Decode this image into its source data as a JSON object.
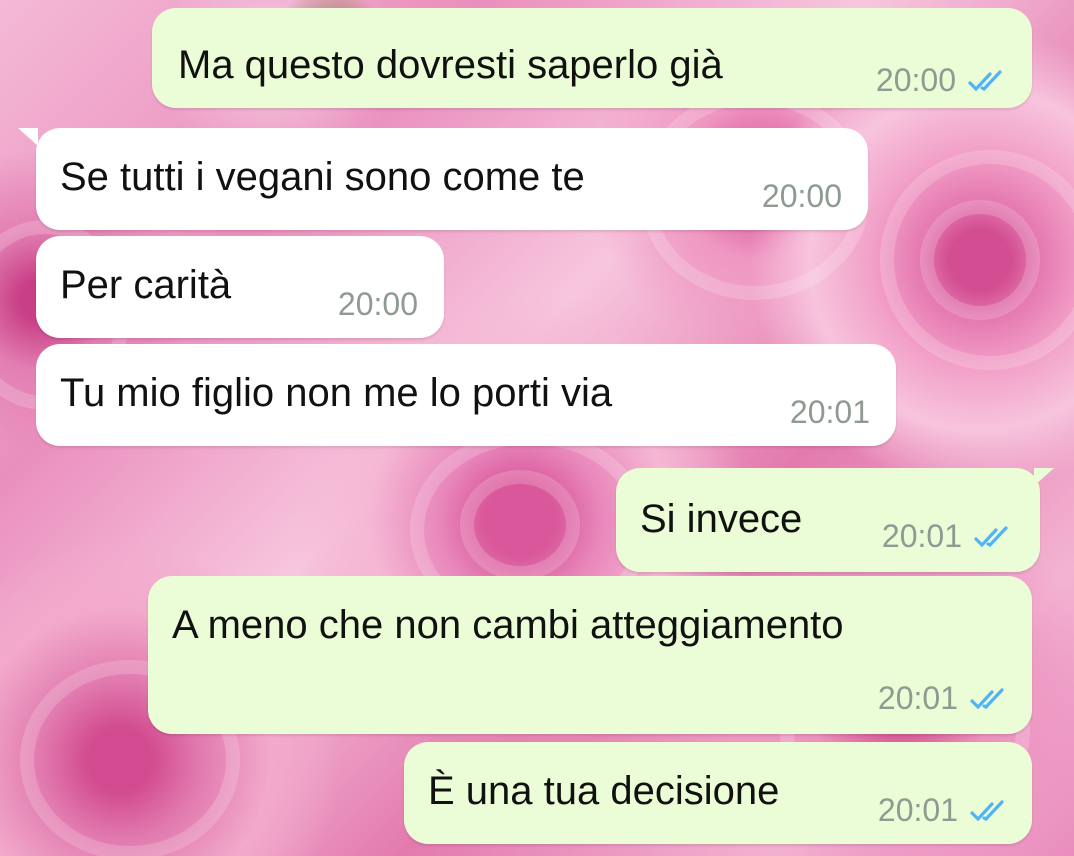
{
  "chat": {
    "messages": [
      {
        "text": "Ma questo dovresti saperlo già",
        "time": "20:00",
        "direction": "out",
        "status_icon": "double-check-icon"
      },
      {
        "text": "Se tutti i vegani sono come te",
        "time": "20:00",
        "direction": "in"
      },
      {
        "text": "Per carità",
        "time": "20:00",
        "direction": "in"
      },
      {
        "text": "Tu mio figlio non me lo porti via",
        "time": "20:01",
        "direction": "in"
      },
      {
        "text": "Si invece",
        "time": "20:01",
        "direction": "out",
        "status_icon": "double-check-icon"
      },
      {
        "text": "A meno che non cambi atteggiamento",
        "time": "20:01",
        "direction": "out",
        "status_icon": "double-check-icon"
      },
      {
        "text": "È una tua decisione",
        "time": "20:01",
        "direction": "out",
        "status_icon": "double-check-icon"
      }
    ],
    "colors": {
      "outgoing_bubble": "#eafdd6",
      "incoming_bubble": "#ffffff",
      "read_tick": "#4fb3f6",
      "timestamp": "#8e9a92",
      "wallpaper": "pink-roses"
    }
  }
}
